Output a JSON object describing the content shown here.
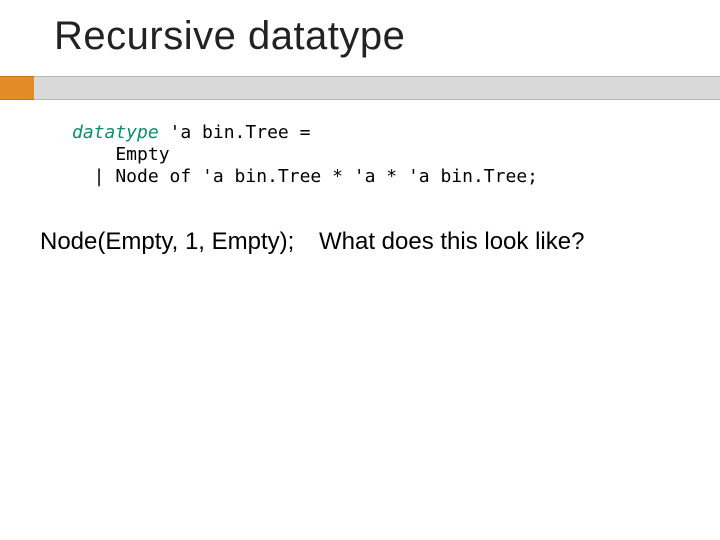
{
  "title": "Recursive datatype",
  "code": {
    "keyword": "datatype",
    "line1_rest": " 'a bin.Tree =",
    "line2": "    Empty",
    "line3": "  | Node of 'a bin.Tree * 'a * 'a bin.Tree;"
  },
  "example": {
    "expr": "Node(Empty, 1, Empty);",
    "question": "What does this look like?"
  }
}
